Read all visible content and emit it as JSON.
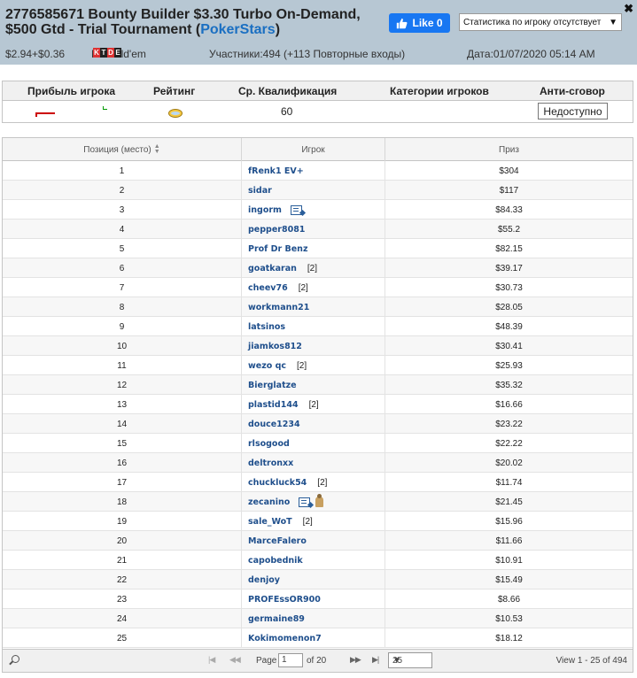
{
  "header": {
    "title_main": "2776585671 Bounty Builder $3.30 Turbo On-Demand, $500 Gtd - Trial Tournament (",
    "title_site": "PokerStars",
    "title_end": ")",
    "close_label": "✖",
    "fb_like_label": "Like 0",
    "stats_select_value": "Статистика по игроку отсутствует",
    "buyin": "$2.94+$0.36",
    "game": "NL Hold'em",
    "game_badge": [
      "K",
      "T",
      "D",
      "E"
    ],
    "participants": "Участники:494 (+113 Повторные входы)",
    "date": "Дата:01/07/2020 05:14 AM"
  },
  "summary": {
    "headers": [
      "Прибыль игрока",
      "Рейтинг",
      "Ср. Квалификация",
      "Категории игроков",
      "Анти-сговор"
    ],
    "avg_qualification": "60",
    "anti_collusion_button": "Недоступно"
  },
  "grid": {
    "col_position": "Позиция (место)",
    "col_player": "Игрок",
    "col_prize": "Приз",
    "rows": [
      {
        "pos": "1",
        "player": "fRenk1 EV+",
        "re": "",
        "prize": "$304",
        "note": false,
        "player_icon": false
      },
      {
        "pos": "2",
        "player": "sidar",
        "re": "",
        "prize": "$117",
        "note": false,
        "player_icon": false
      },
      {
        "pos": "3",
        "player": "ingorm",
        "re": "",
        "prize": "$84.33",
        "note": true,
        "player_icon": false
      },
      {
        "pos": "4",
        "player": "pepper8081",
        "re": "",
        "prize": "$55.2",
        "note": false,
        "player_icon": false
      },
      {
        "pos": "5",
        "player": "Prof Dr Benz",
        "re": "",
        "prize": "$82.15",
        "note": false,
        "player_icon": false
      },
      {
        "pos": "6",
        "player": "goatkaran",
        "re": "[2]",
        "prize": "$39.17",
        "note": false,
        "player_icon": false
      },
      {
        "pos": "7",
        "player": "cheev76",
        "re": "[2]",
        "prize": "$30.73",
        "note": false,
        "player_icon": false
      },
      {
        "pos": "8",
        "player": "workmann21",
        "re": "",
        "prize": "$28.05",
        "note": false,
        "player_icon": false
      },
      {
        "pos": "9",
        "player": "latsinos",
        "re": "",
        "prize": "$48.39",
        "note": false,
        "player_icon": false
      },
      {
        "pos": "10",
        "player": "jiamkos812",
        "re": "",
        "prize": "$30.41",
        "note": false,
        "player_icon": false
      },
      {
        "pos": "11",
        "player": "wezo qc",
        "re": "[2]",
        "prize": "$25.93",
        "note": false,
        "player_icon": false
      },
      {
        "pos": "12",
        "player": "Bierglatze",
        "re": "",
        "prize": "$35.32",
        "note": false,
        "player_icon": false
      },
      {
        "pos": "13",
        "player": "plastid144",
        "re": "[2]",
        "prize": "$16.66",
        "note": false,
        "player_icon": false
      },
      {
        "pos": "14",
        "player": "douce1234",
        "re": "",
        "prize": "$23.22",
        "note": false,
        "player_icon": false
      },
      {
        "pos": "15",
        "player": "rlsogood",
        "re": "",
        "prize": "$22.22",
        "note": false,
        "player_icon": false
      },
      {
        "pos": "16",
        "player": "deltronxx",
        "re": "",
        "prize": "$20.02",
        "note": false,
        "player_icon": false
      },
      {
        "pos": "17",
        "player": "chuckluck54",
        "re": "[2]",
        "prize": "$11.74",
        "note": false,
        "player_icon": false
      },
      {
        "pos": "18",
        "player": "zecanino",
        "re": "",
        "prize": "$21.45",
        "note": true,
        "player_icon": true
      },
      {
        "pos": "19",
        "player": "sale_WoT",
        "re": "[2]",
        "prize": "$15.96",
        "note": false,
        "player_icon": false
      },
      {
        "pos": "20",
        "player": "MarceFalero",
        "re": "",
        "prize": "$11.66",
        "note": false,
        "player_icon": false
      },
      {
        "pos": "21",
        "player": "capobednik",
        "re": "",
        "prize": "$10.91",
        "note": false,
        "player_icon": false
      },
      {
        "pos": "22",
        "player": "denjoy",
        "re": "",
        "prize": "$15.49",
        "note": false,
        "player_icon": false
      },
      {
        "pos": "23",
        "player": "PROFEssOR900",
        "re": "",
        "prize": "$8.66",
        "note": false,
        "player_icon": false
      },
      {
        "pos": "24",
        "player": "germaine89",
        "re": "",
        "prize": "$10.53",
        "note": false,
        "player_icon": false
      },
      {
        "pos": "25",
        "player": "Kokimomenon7",
        "re": "",
        "prize": "$18.12",
        "note": false,
        "player_icon": false
      }
    ]
  },
  "pager": {
    "page_label": "Page",
    "page_value": "1",
    "of_label": "of 20",
    "rows_per_page": "25",
    "view_label": "View 1 - 25 of 494"
  },
  "colors": {
    "header_bg": "#b7c7d3",
    "link": "#1f4f8c",
    "site_link": "#1a6fc2",
    "fb_blue": "#1877f2"
  }
}
